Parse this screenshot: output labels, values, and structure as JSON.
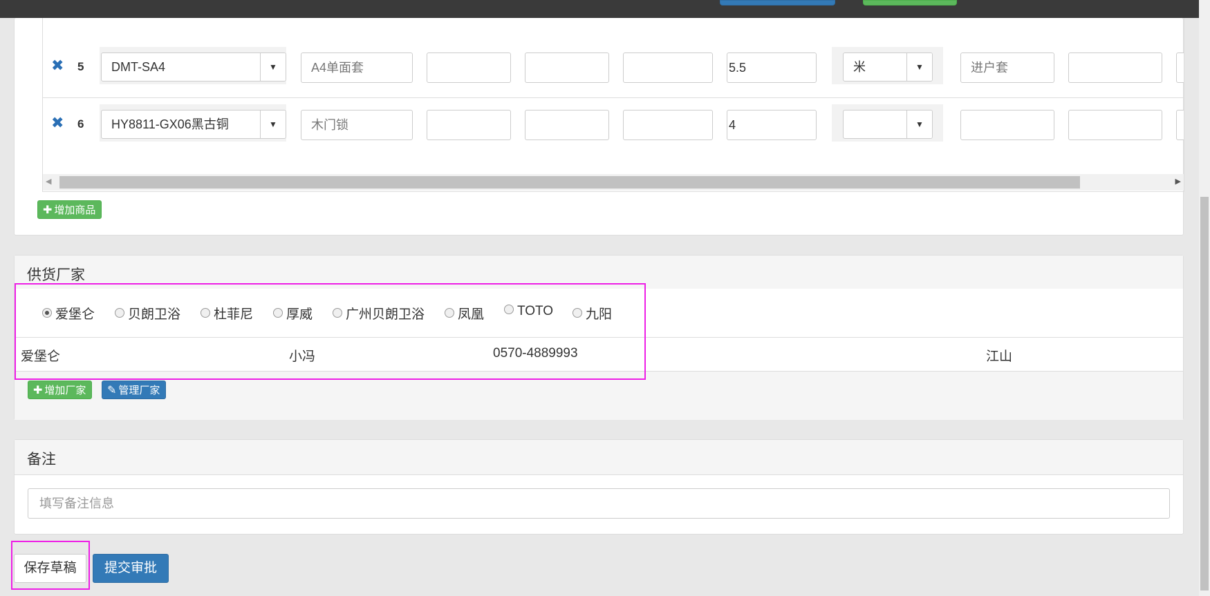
{
  "products": {
    "rows": [
      {
        "index": "5",
        "model": "DMT-SA4",
        "name": "A4单面套",
        "field3": "",
        "field4": "",
        "field5": "",
        "quantity": "5.5",
        "unit": "米",
        "location": "进户套",
        "field9": ""
      },
      {
        "index": "6",
        "model": "HY8811-GX06黑古铜",
        "name": "木门锁",
        "field3": "",
        "field4": "",
        "field5": "",
        "quantity": "4",
        "unit": "",
        "location": "",
        "field9": ""
      }
    ],
    "add_button": "增加商品"
  },
  "supplier": {
    "title": "供货厂家",
    "options": [
      "爱堡仑",
      "贝朗卫浴",
      "杜菲尼",
      "厚威",
      "广州贝朗卫浴",
      "凤凰",
      "TOTO",
      "九阳"
    ],
    "selected": "爱堡仑",
    "info": {
      "name": "爱堡仑",
      "contact": "小冯",
      "phone": "0570-4889993",
      "city": "江山"
    },
    "add_button": "增加厂家",
    "manage_button": "管理厂家"
  },
  "notes": {
    "title": "备注",
    "placeholder": "填写备注信息"
  },
  "actions": {
    "save_draft": "保存草稿",
    "submit": "提交审批"
  },
  "colors": {
    "primary": "#337ab7",
    "success": "#5cb85c",
    "highlight": "#ee1ee6"
  }
}
